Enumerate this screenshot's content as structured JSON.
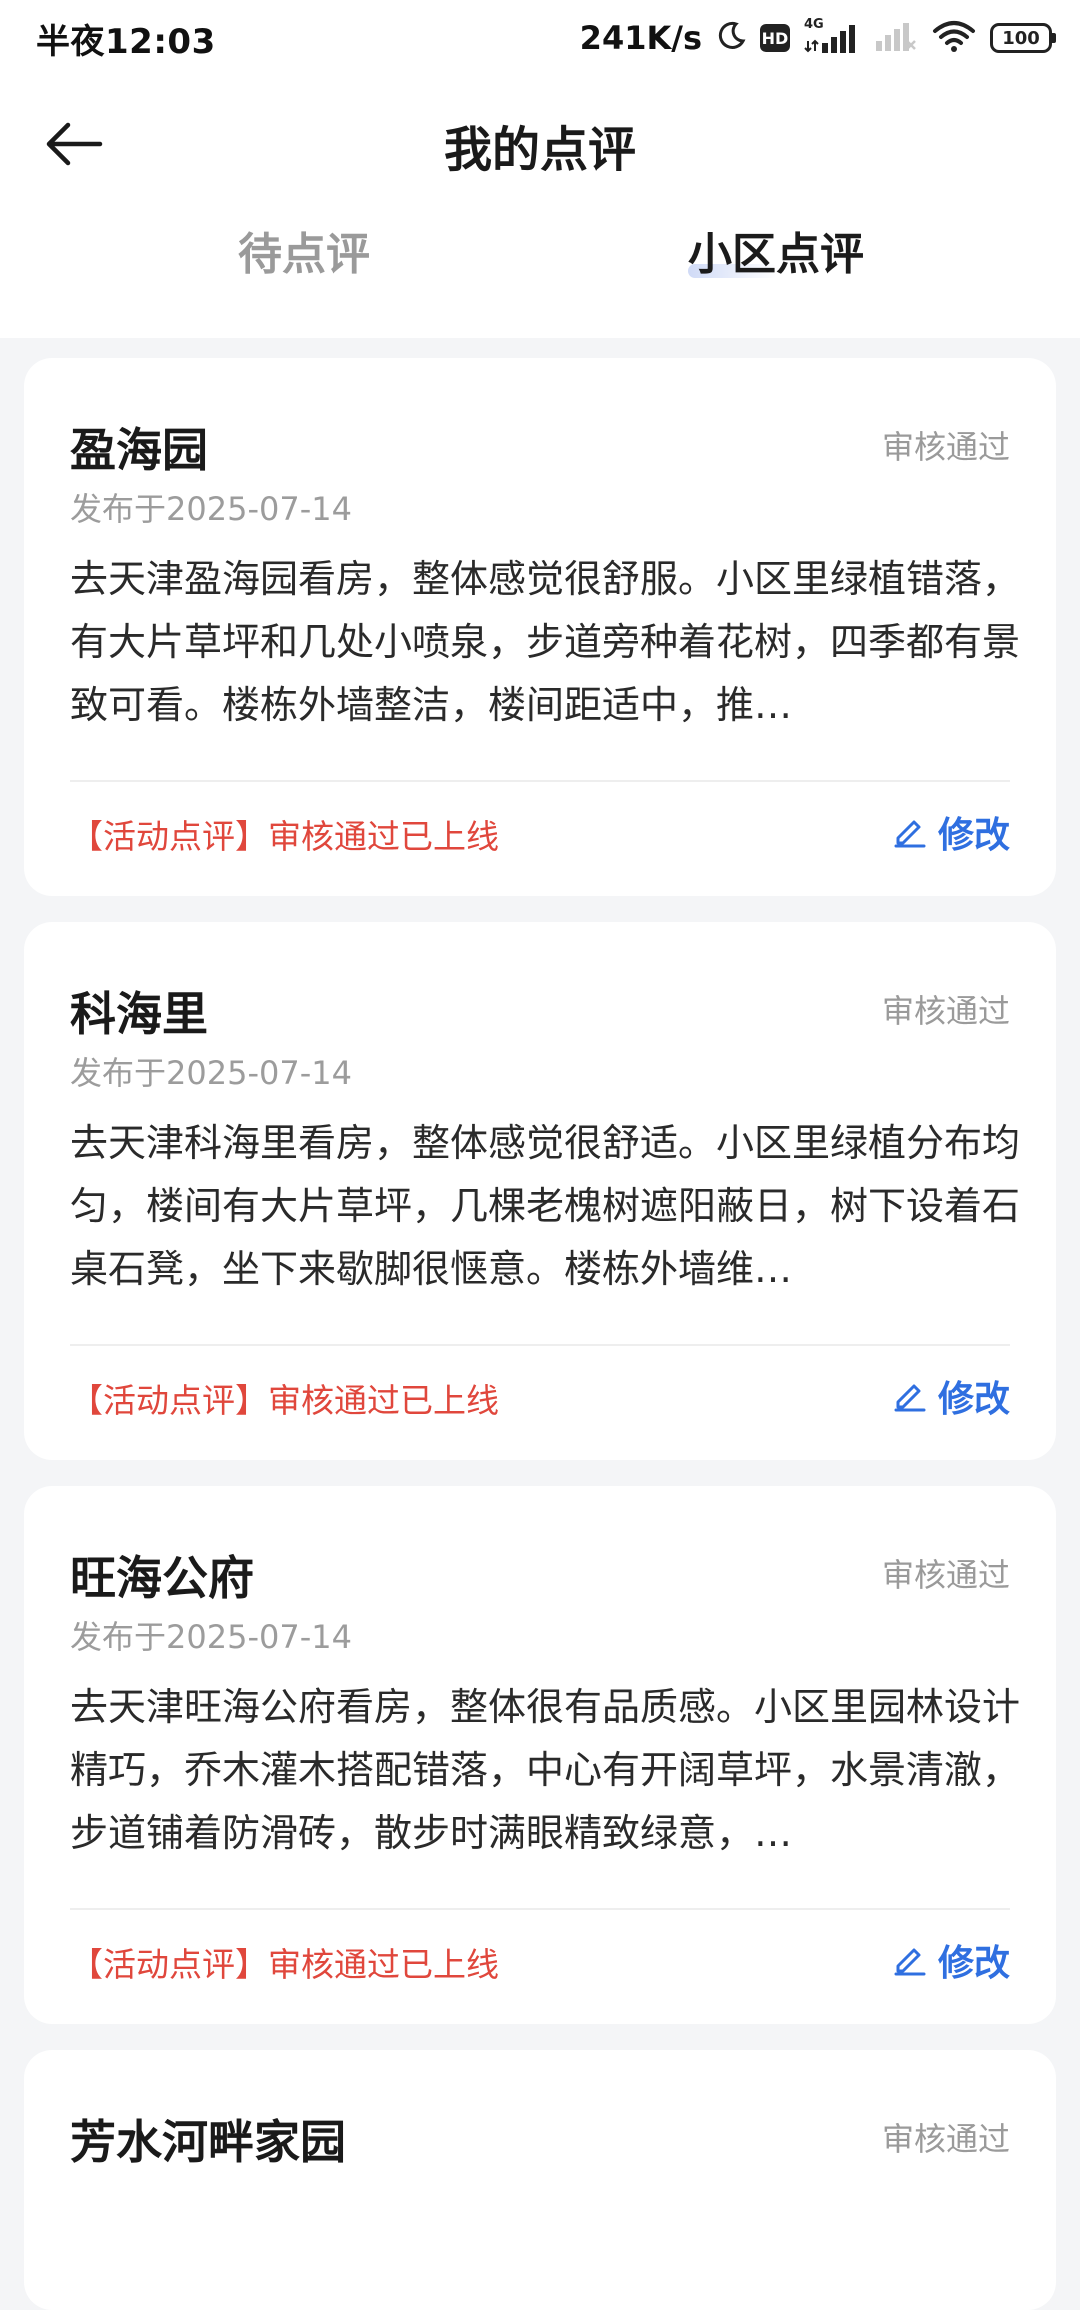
{
  "status_bar": {
    "time": "半夜12:03",
    "net_speed": "241K/s",
    "hd": "HD",
    "network": "4G",
    "battery": "100"
  },
  "header": {
    "title": "我的点评",
    "back_icon": "arrow-left-icon"
  },
  "tabs": [
    {
      "label": "待点评",
      "active": false
    },
    {
      "label": "小区点评",
      "active": true
    }
  ],
  "colors": {
    "tag": "#e0473c",
    "edit": "#2f6fe0",
    "status": "#9a9a9a"
  },
  "reviews": [
    {
      "title": "盈海园",
      "status": "审核通过",
      "date": "发布于2025-07-14",
      "body": "去天津盈海园看房，整体感觉很舒服。小区里绿植错落，有大片草坪和几处小喷泉，步道旁种着花树，四季都有景致可看。楼栋外墙整洁，楼间距适中，推…",
      "tag": "【活动点评】审核通过已上线",
      "edit_label": "修改"
    },
    {
      "title": "科海里",
      "status": "审核通过",
      "date": "发布于2025-07-14",
      "body": "去天津科海里看房，整体感觉很舒适。小区里绿植分布均匀，楼间有大片草坪，几棵老槐树遮阳蔽日，树下设着石桌石凳，坐下来歇脚很惬意。楼栋外墙维…",
      "tag": "【活动点评】审核通过已上线",
      "edit_label": "修改"
    },
    {
      "title": "旺海公府",
      "status": "审核通过",
      "date": "发布于2025-07-14",
      "body": "去天津旺海公府看房，整体很有品质感。小区里园林设计精巧，乔木灌木搭配错落，中心有开阔草坪，水景清澈，步道铺着防滑砖，散步时满眼精致绿意，…",
      "tag": "【活动点评】审核通过已上线",
      "edit_label": "修改"
    },
    {
      "title": "芳水河畔家园",
      "status": "审核通过"
    }
  ]
}
